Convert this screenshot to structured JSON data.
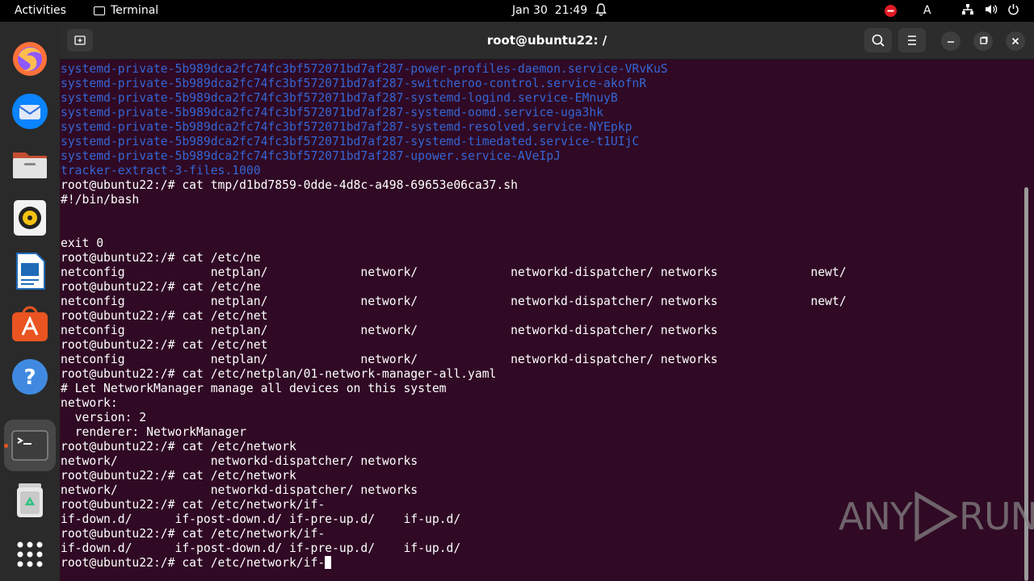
{
  "topbar": {
    "activities": "Activities",
    "app_name": "Terminal",
    "date": "Jan 30",
    "time": "21:49",
    "input_source": "A"
  },
  "window": {
    "title": "root@ubuntu22: /"
  },
  "terminal": {
    "lines": [
      {
        "text": "systemd-private-5b989dca2fc74fc3bf572071bd7af287-power-profiles-daemon.service-VRvKuS",
        "color": "blue"
      },
      {
        "text": "systemd-private-5b989dca2fc74fc3bf572071bd7af287-switcheroo-control.service-akofnR",
        "color": "blue"
      },
      {
        "text": "systemd-private-5b989dca2fc74fc3bf572071bd7af287-systemd-logind.service-EMnuyB",
        "color": "blue"
      },
      {
        "text": "systemd-private-5b989dca2fc74fc3bf572071bd7af287-systemd-oomd.service-uga3hk",
        "color": "blue"
      },
      {
        "text": "systemd-private-5b989dca2fc74fc3bf572071bd7af287-systemd-resolved.service-NYEpkp",
        "color": "blue"
      },
      {
        "text": "systemd-private-5b989dca2fc74fc3bf572071bd7af287-systemd-timedated.service-t1UIjC",
        "color": "blue"
      },
      {
        "text": "systemd-private-5b989dca2fc74fc3bf572071bd7af287-upower.service-AVeIpJ",
        "color": "blue"
      },
      {
        "text": "tracker-extract-3-files.1000",
        "color": "blue"
      },
      {
        "text": "root@ubuntu22:/# cat tmp/d1bd7859-0dde-4d8c-a498-69653e06ca37.sh",
        "color": "white"
      },
      {
        "text": "#!/bin/bash",
        "color": "white"
      },
      {
        "text": "",
        "color": "white"
      },
      {
        "text": "",
        "color": "white"
      },
      {
        "text": "exit 0",
        "color": "white"
      },
      {
        "text": "root@ubuntu22:/# cat /etc/ne",
        "color": "white"
      },
      {
        "text": "netconfig            netplan/             network/             networkd-dispatcher/ networks             newt/",
        "color": "white"
      },
      {
        "text": "root@ubuntu22:/# cat /etc/ne",
        "color": "white"
      },
      {
        "text": "netconfig            netplan/             network/             networkd-dispatcher/ networks             newt/",
        "color": "white"
      },
      {
        "text": "root@ubuntu22:/# cat /etc/net",
        "color": "white"
      },
      {
        "text": "netconfig            netplan/             network/             networkd-dispatcher/ networks",
        "color": "white"
      },
      {
        "text": "root@ubuntu22:/# cat /etc/net",
        "color": "white"
      },
      {
        "text": "netconfig            netplan/             network/             networkd-dispatcher/ networks",
        "color": "white"
      },
      {
        "text": "root@ubuntu22:/# cat /etc/netplan/01-network-manager-all.yaml",
        "color": "white"
      },
      {
        "text": "# Let NetworkManager manage all devices on this system",
        "color": "white"
      },
      {
        "text": "network:",
        "color": "white"
      },
      {
        "text": "  version: 2",
        "color": "white"
      },
      {
        "text": "  renderer: NetworkManager",
        "color": "white"
      },
      {
        "text": "root@ubuntu22:/# cat /etc/network",
        "color": "white"
      },
      {
        "text": "network/             networkd-dispatcher/ networks",
        "color": "white"
      },
      {
        "text": "root@ubuntu22:/# cat /etc/network",
        "color": "white"
      },
      {
        "text": "network/             networkd-dispatcher/ networks",
        "color": "white"
      },
      {
        "text": "root@ubuntu22:/# cat /etc/network/if-",
        "color": "white"
      },
      {
        "text": "if-down.d/      if-post-down.d/ if-pre-up.d/    if-up.d/",
        "color": "white"
      },
      {
        "text": "root@ubuntu22:/# cat /etc/network/if-",
        "color": "white"
      },
      {
        "text": "if-down.d/      if-post-down.d/ if-pre-up.d/    if-up.d/",
        "color": "white"
      },
      {
        "text": "root@ubuntu22:/# cat /etc/network/if-",
        "color": "white",
        "cursor": true
      }
    ]
  },
  "dock": {
    "items": [
      {
        "name": "firefox-icon"
      },
      {
        "name": "thunderbird-icon"
      },
      {
        "name": "files-icon"
      },
      {
        "name": "rhythmbox-icon"
      },
      {
        "name": "libreoffice-writer-icon"
      },
      {
        "name": "app-center-icon"
      },
      {
        "name": "help-icon"
      },
      {
        "name": "terminal-icon"
      },
      {
        "name": "trash-icon"
      },
      {
        "name": "show-apps-icon"
      }
    ]
  },
  "watermark": {
    "text_left": "ANY",
    "text_right": "RUN"
  },
  "colors": {
    "terminal_bg": "#300a24",
    "dir_blue": "#3465d4",
    "accent": "#e95420"
  }
}
